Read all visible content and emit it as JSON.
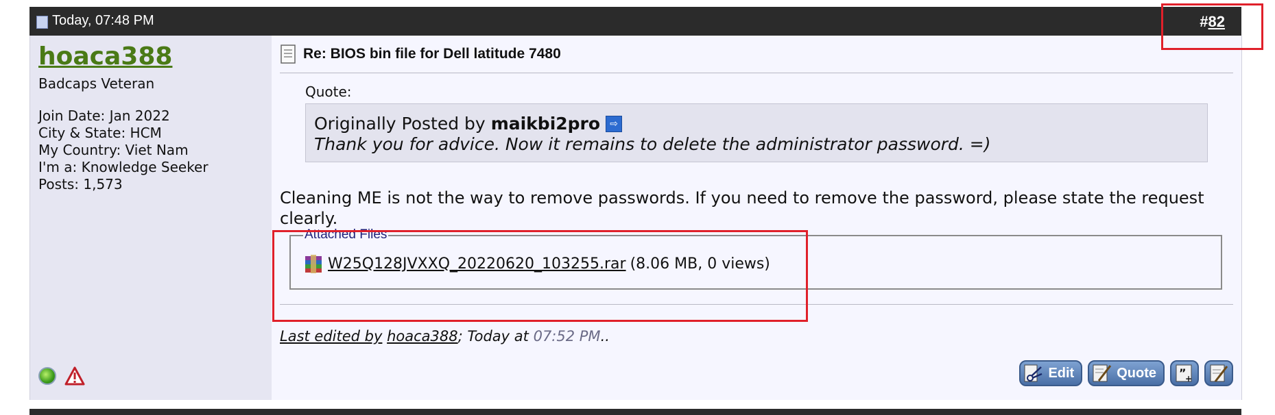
{
  "header": {
    "date": "Today, 07:48 PM",
    "post_hash": "#",
    "post_number": "82"
  },
  "user": {
    "username": "hoaca388",
    "title": "Badcaps Veteran",
    "join_date": "Join Date: Jan 2022",
    "city_state": "City & State: HCM",
    "country": "My Country: Viet Nam",
    "role": "I'm a: Knowledge Seeker",
    "posts": "Posts: 1,573"
  },
  "post": {
    "title": "Re: BIOS bin file for Dell latitude 7480",
    "quote_label": "Quote:",
    "quote_prefix": "Originally Posted by",
    "quote_author": "maikbi2pro",
    "quote_text": "Thank you for advice. Now it remains to delete the administrator password. =)",
    "message": "Cleaning ME is not the way to remove passwords. If you need to remove the password, please state the request clearly.",
    "attachments_legend": "Attached Files",
    "attachment_name": "W25Q128JVXXQ_20220620_103255.rar",
    "attachment_meta": "(8.06 MB, 0 views)",
    "edited_prefix": "Last edited by",
    "edited_by": "hoaca388",
    "edited_mid": "; Today at",
    "edited_time": "07:52 PM",
    "edited_suffix": ".."
  },
  "buttons": {
    "edit": "Edit",
    "quote": "Quote"
  },
  "icons": {
    "page": "page-icon",
    "online": "online-status-icon",
    "report": "report-icon",
    "post": "post-icon",
    "view_post": "view-post-icon",
    "archive": "rar-archive-icon",
    "edit": "scissors-edit-icon",
    "quote": "quote-icon",
    "multiquote": "multiquote-icon",
    "quick_reply": "quick-reply-icon"
  },
  "colors": {
    "header_bg": "#2b2b2b",
    "username": "#4a7a16",
    "highlight": "#e0202a",
    "legend": "#22227a"
  }
}
